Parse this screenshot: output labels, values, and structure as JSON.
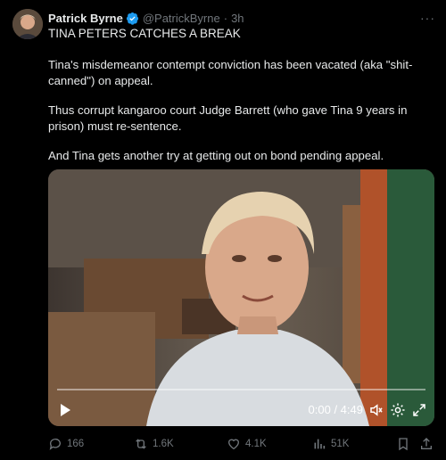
{
  "author": {
    "name": "Patrick Byrne",
    "handle": "@PatrickByrne",
    "separator": "·",
    "time": "3h",
    "verified": true,
    "avatar_icon": "profile-photo"
  },
  "more_icon": "ellipsis-icon",
  "tweet": {
    "headline": "TINA PETERS CATCHES A BREAK",
    "paragraphs": [
      "Tina's misdemeanor contempt conviction has been vacated (aka \"shit-canned\") on appeal.",
      "Thus corrupt kangaroo court Judge Barrett (who gave Tina 9 years in prison) must re-sentence.",
      "And Tina gets another try at getting out on bond pending appeal."
    ]
  },
  "video": {
    "time": "0:00 / 4:49",
    "progress": 0,
    "controls": [
      "play-icon",
      "volume-icon",
      "settings-gear-icon",
      "fullscreen-icon"
    ]
  },
  "actions": {
    "replies": "166",
    "reposts": "1.6K",
    "likes": "4.1K",
    "views": "51K"
  },
  "colors": {
    "background": "#000000",
    "text": "#e7e9ea",
    "muted": "#71767b",
    "verified": "#1d9bf0"
  }
}
